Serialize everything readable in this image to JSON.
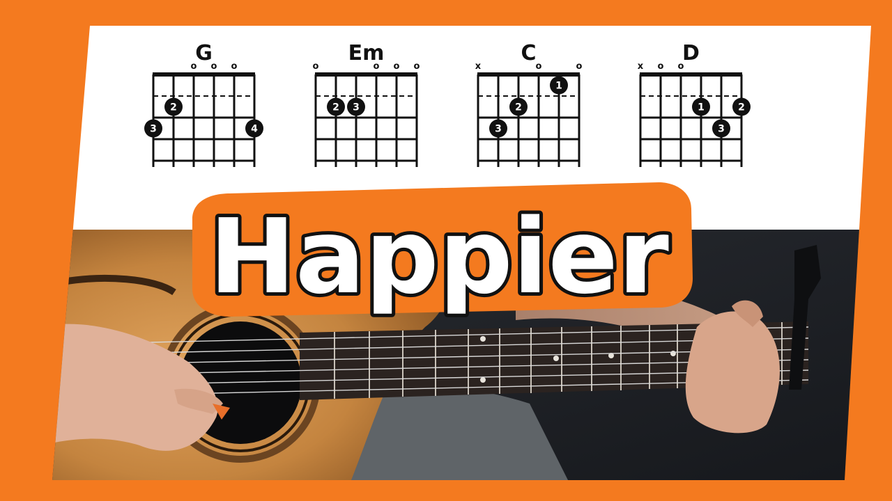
{
  "title": "Happier",
  "colors": {
    "frame_orange": "#f47a1f",
    "panel_white": "#ffffff",
    "title_fill": "#ffffff",
    "title_outline": "#111111",
    "title_glow": "#f47a1f",
    "dark_background": "#1c1f24",
    "guitar_body": "#c98a45",
    "fretboard": "#2b2320"
  },
  "chords": [
    {
      "name": "G",
      "string_markers": [
        "",
        "",
        "o",
        "o",
        "o",
        ""
      ],
      "fingers": [
        {
          "string": 1,
          "fret": 3,
          "finger": "3"
        },
        {
          "string": 2,
          "fret": 2,
          "finger": "2"
        },
        {
          "string": 6,
          "fret": 3,
          "finger": "4"
        }
      ]
    },
    {
      "name": "Em",
      "string_markers": [
        "o",
        "",
        "",
        "o",
        "o",
        "o"
      ],
      "fingers": [
        {
          "string": 2,
          "fret": 2,
          "finger": "2"
        },
        {
          "string": 3,
          "fret": 2,
          "finger": "3"
        }
      ]
    },
    {
      "name": "C",
      "string_markers": [
        "x",
        "",
        "",
        "o",
        "",
        "o"
      ],
      "fingers": [
        {
          "string": 5,
          "fret": 1,
          "finger": "1"
        },
        {
          "string": 3,
          "fret": 2,
          "finger": "2"
        },
        {
          "string": 2,
          "fret": 3,
          "finger": "3"
        }
      ]
    },
    {
      "name": "D",
      "string_markers": [
        "x",
        "o",
        "o",
        "",
        "",
        ""
      ],
      "fingers": [
        {
          "string": 4,
          "fret": 2,
          "finger": "1"
        },
        {
          "string": 6,
          "fret": 2,
          "finger": "2"
        },
        {
          "string": 5,
          "fret": 3,
          "finger": "3"
        }
      ]
    }
  ],
  "icons": {
    "sound_hole": "guitar-soundhole-icon",
    "pick": "guitar-pick-icon"
  }
}
